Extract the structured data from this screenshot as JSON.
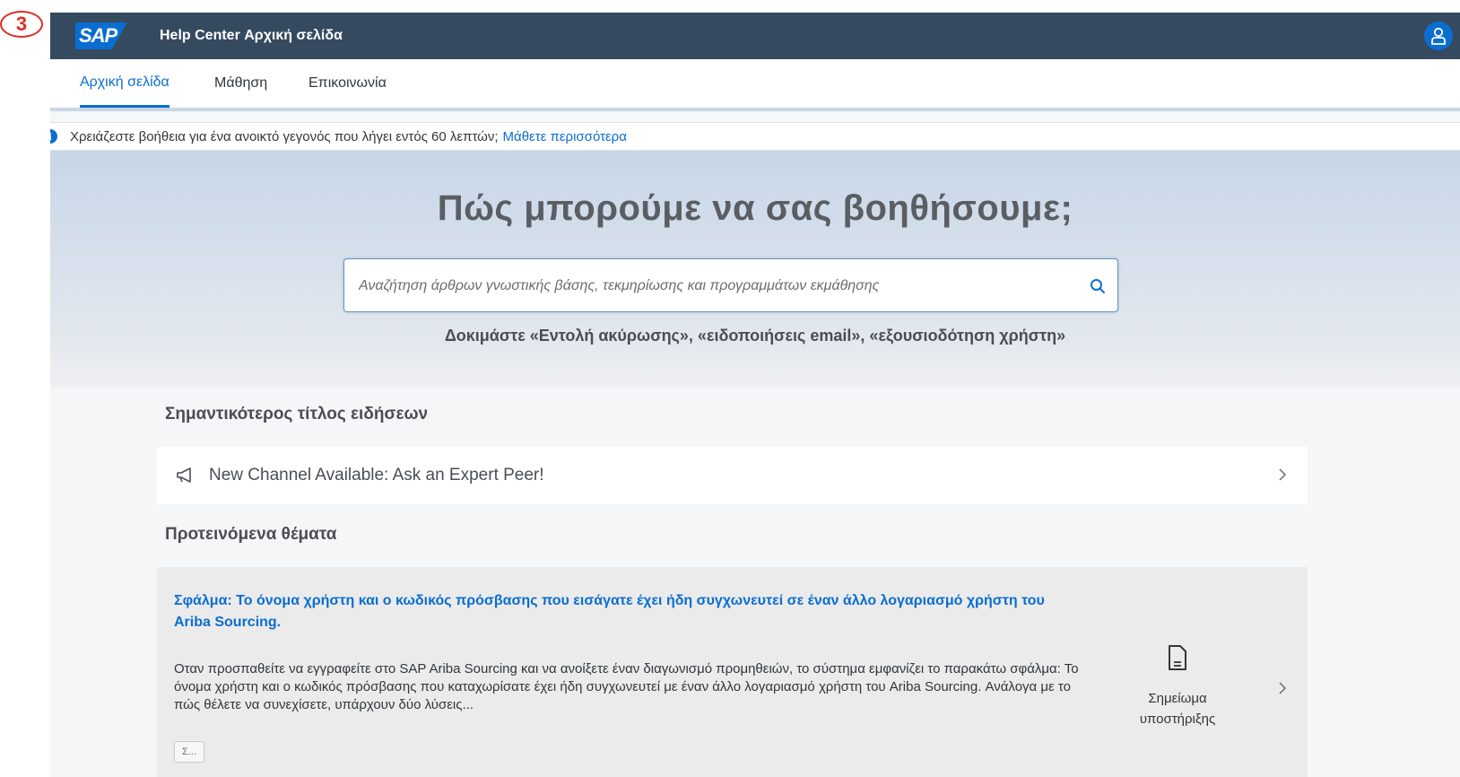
{
  "step_marker": "3",
  "shellbar": {
    "logo_text": "SAP",
    "title": "Help Center Αρχική σελίδα",
    "avatar_icon": "user-icon"
  },
  "tabs": [
    {
      "label": "Αρχική σελίδα",
      "active": true
    },
    {
      "label": "Μάθηση",
      "active": false
    },
    {
      "label": "Επικοινωνία",
      "active": false
    }
  ],
  "infobar": {
    "icon": "info-icon",
    "text": "Χρειάζεστε βοήθεια για ένα ανοικτό γεγονός που λήγει εντός 60 λεπτών;",
    "link": "Μάθετε περισσότερα"
  },
  "hero": {
    "title": "Πώς μπορούμε να σας βοηθήσουμε;",
    "search_placeholder": "Αναζήτηση άρθρων γνωστικής βάσης, τεκμηρίωσης και προγραμμάτων εκμάθησης",
    "search_value": "",
    "try_text": "Δοκιμάστε  «Εντολή ακύρωσης», «ειδοποιήσεις email», «εξουσιοδότηση χρήστη»"
  },
  "news": {
    "section_title": "Σημαντικότερος τίτλος ειδήσεων",
    "item_text": "New Channel Available: Ask an Expert Peer!",
    "item_icon": "megaphone-icon"
  },
  "recommended": {
    "section_title": "Προτεινόμενα θέματα",
    "topic": {
      "title": "Σφάλμα: Το όνομα χρήστη και ο κωδικός πρόσβασης που εισάγατε έχει ήδη συγχωνευτεί σε έναν άλλο λογαριασμό χρήστη του Ariba Sourcing.",
      "description": "Οταν προσπαθείτε να εγγραφείτε στο SAP Ariba Sourcing και να ανοίξετε έναν διαγωνισμό προμηθειών, το σύστημα εμφανίζει το παρακάτω σφάλμα: Το όνομα χρήστη και ο κωδικός πρόσβασης που καταχωρίσατε έχει ήδη συγχωνευτεί με έναν άλλο λογαριασμό χρήστη του Ariba Sourcing. Ανάλογα με το πώς θέλετε να συνεχίσετε, υπάρχουν δύο λύσεις...",
      "type_label": "Σημείωμα υποστήριξης",
      "type_icon": "document-icon",
      "tag": "Σ..."
    }
  },
  "colors": {
    "shellbar": "#354a5f",
    "accent": "#0a6ed1",
    "marker": "#d93025"
  }
}
